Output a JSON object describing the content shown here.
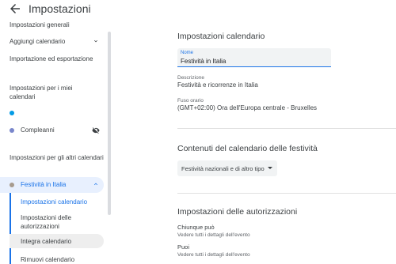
{
  "header": {
    "title": "Impostazioni"
  },
  "sidebar": {
    "general_items": [
      {
        "label": "Impostazioni generali"
      },
      {
        "label": "Aggiungi calendario"
      },
      {
        "label": "Importazione ed esportazione"
      }
    ],
    "my_calendars_heading": "Impostazioni per i miei calendari",
    "my_calendars": [
      {
        "label": "",
        "color": "#039be5"
      },
      {
        "label": "Compleanni",
        "color": "#7986cb"
      }
    ],
    "other_calendars_heading": "Impostazioni per gli altri calendari",
    "other_calendar": {
      "label": "Festività in Italia",
      "color": "#a79b8e"
    },
    "sub_items": [
      {
        "label": "Impostazioni calendario"
      },
      {
        "label": "Impostazioni delle autorizzazioni"
      },
      {
        "label": "Integra calendario"
      },
      {
        "label": "Rimuovi calendario"
      }
    ]
  },
  "main": {
    "calendar_settings": {
      "heading": "Impostazioni calendario",
      "name_label": "Nome",
      "name_value": "Festività in Italia",
      "description_label": "Descrizione",
      "description_value": "Festività e ricorrenze in Italia",
      "timezone_label": "Fuso orario",
      "timezone_value": "(GMT+02:00) Ora dell'Europa centrale - Bruxelles"
    },
    "holiday_content": {
      "heading": "Contenuti del calendario delle festività",
      "dropdown_value": "Festività nazionali e di altro tipo"
    },
    "permissions": {
      "heading": "Impostazioni delle autorizzazioni",
      "anyone_label": "Chiunque può",
      "anyone_value": "Vedere tutti i dettagli dell'evento",
      "public_label": "Puoi",
      "public_value": "Vedere tutti i dettagli dell'evento"
    }
  },
  "colors": {
    "accent": "#1a73e8",
    "active_bg": "#e8f0fe"
  }
}
